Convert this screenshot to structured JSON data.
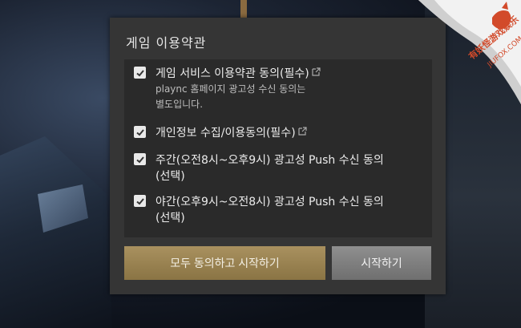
{
  "dialog": {
    "title": "게임 이용약관",
    "terms": [
      {
        "label": "게임 서비스 이용약관 동의(필수)",
        "checked": true,
        "has_link": true,
        "note_lines": [
          "plaync 홈페이지 광고성 수신 동의는",
          "별도입니다."
        ]
      },
      {
        "label": "개인정보 수집/이용동의(필수)",
        "checked": true,
        "has_link": true
      },
      {
        "label_lines": [
          "주간(오전8시~오후9시) 광고성 Push 수신 동의",
          "(선택)"
        ],
        "checked": true
      },
      {
        "label_lines": [
          "야간(오후9시~오전8시) 광고성 Push 수신 동의",
          "(선택)"
        ],
        "checked": true
      }
    ],
    "buttons": {
      "agree_all": "모두 동의하고 시작하기",
      "start": "시작하기"
    }
  },
  "watermark": {
    "brand": "有妖怪游戏娱乐",
    "site": "JIUFOX.COM"
  },
  "colors": {
    "dialog_bg": "#353535",
    "list_bg": "#2a2a2a",
    "agree_button": "#a08a5a",
    "start_button": "#808080",
    "watermark": "#d24a2a"
  }
}
